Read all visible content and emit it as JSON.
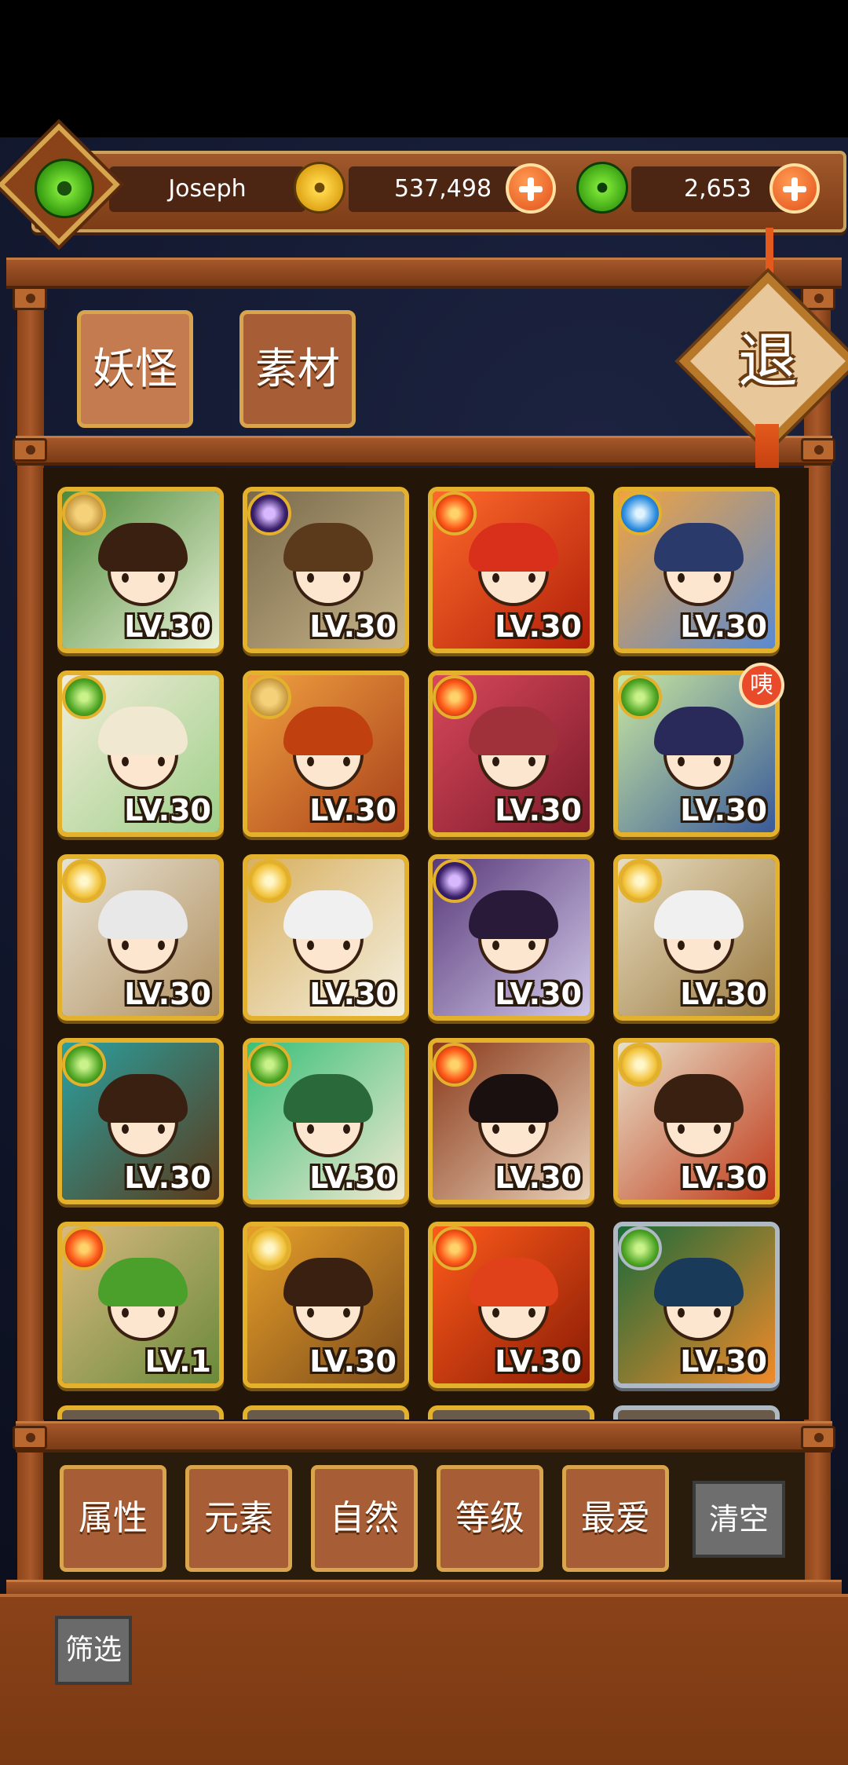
{
  "header": {
    "player_name": "Joseph",
    "gold_amount": "537,498",
    "jade_amount": "2,653"
  },
  "tabs": [
    {
      "label": "妖怪",
      "active": true
    },
    {
      "label": "素材",
      "active": false
    }
  ],
  "exit_label": "退",
  "cards": [
    {
      "level": "LV.30",
      "element": "earth",
      "frame": "gold"
    },
    {
      "level": "LV.30",
      "element": "dark",
      "frame": "gold"
    },
    {
      "level": "LV.30",
      "element": "fire",
      "frame": "gold"
    },
    {
      "level": "LV.30",
      "element": "water",
      "frame": "gold"
    },
    {
      "level": "LV.30",
      "element": "leaf",
      "frame": "gold"
    },
    {
      "level": "LV.30",
      "element": "earth",
      "frame": "gold"
    },
    {
      "level": "LV.30",
      "element": "fire",
      "frame": "gold"
    },
    {
      "level": "LV.30",
      "element": "leaf",
      "frame": "gold",
      "badge": "咦"
    },
    {
      "level": "LV.30",
      "element": "light",
      "frame": "gold"
    },
    {
      "level": "LV.30",
      "element": "light",
      "frame": "gold"
    },
    {
      "level": "LV.30",
      "element": "dark",
      "frame": "gold"
    },
    {
      "level": "LV.30",
      "element": "light",
      "frame": "gold"
    },
    {
      "level": "LV.30",
      "element": "leaf",
      "frame": "gold"
    },
    {
      "level": "LV.30",
      "element": "leaf",
      "frame": "gold"
    },
    {
      "level": "LV.30",
      "element": "fire",
      "frame": "gold"
    },
    {
      "level": "LV.30",
      "element": "light",
      "frame": "gold"
    },
    {
      "level": "LV.1",
      "element": "fire",
      "frame": "gold"
    },
    {
      "level": "LV.30",
      "element": "light",
      "frame": "gold"
    },
    {
      "level": "LV.30",
      "element": "fire",
      "frame": "gold"
    },
    {
      "level": "LV.30",
      "element": "leaf",
      "frame": "silver"
    }
  ],
  "filters": [
    {
      "label": "属性"
    },
    {
      "label": "元素"
    },
    {
      "label": "自然"
    },
    {
      "label": "等级"
    },
    {
      "label": "最爱"
    }
  ],
  "clear_label": "清空",
  "filter_toggle_label": "筛选",
  "colors": {
    "wood": "#a1582b",
    "gold_frame": "#e4b12d",
    "silver_frame": "#aeb9c3",
    "accent_orange": "#e2501a",
    "jade_green": "#3ea515"
  }
}
